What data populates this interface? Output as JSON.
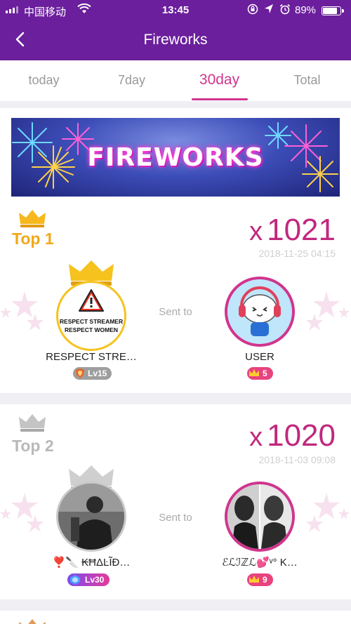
{
  "status": {
    "carrier": "中国移动",
    "time": "13:45",
    "battery": "89%"
  },
  "header": {
    "title": "Fireworks"
  },
  "tabs": [
    {
      "label": "today"
    },
    {
      "label": "7day"
    },
    {
      "label": "30day"
    },
    {
      "label": "Total"
    }
  ],
  "banner": {
    "text": "FIREWORKS"
  },
  "sent_label": "Sent to",
  "ranks": [
    {
      "label": "Top 1",
      "x": "x",
      "count": "1021",
      "date": "2018-11-25 04:15",
      "sender": {
        "name": "RESPECT STRE…",
        "level": "Lv15",
        "avatar_lines": [
          "RESPECT STREAMER",
          "RESPECT WOMEN"
        ]
      },
      "receiver": {
        "name": "USER",
        "level": "5"
      }
    },
    {
      "label": "Top 2",
      "x": "x",
      "count": "1020",
      "date": "2018-11-03 09:08",
      "sender": {
        "name": "❣️🔪 ₭ĦΔĿĨĐ…",
        "level": "Lv30"
      },
      "receiver": {
        "name": "ℰℒℐℤℒ💕ᵛ° K…",
        "level": "9"
      }
    }
  ],
  "colors": {
    "header": "#6b1f9c",
    "accent": "#d0358e",
    "gold": "#f6b81e",
    "silver": "#b9b9b9"
  }
}
